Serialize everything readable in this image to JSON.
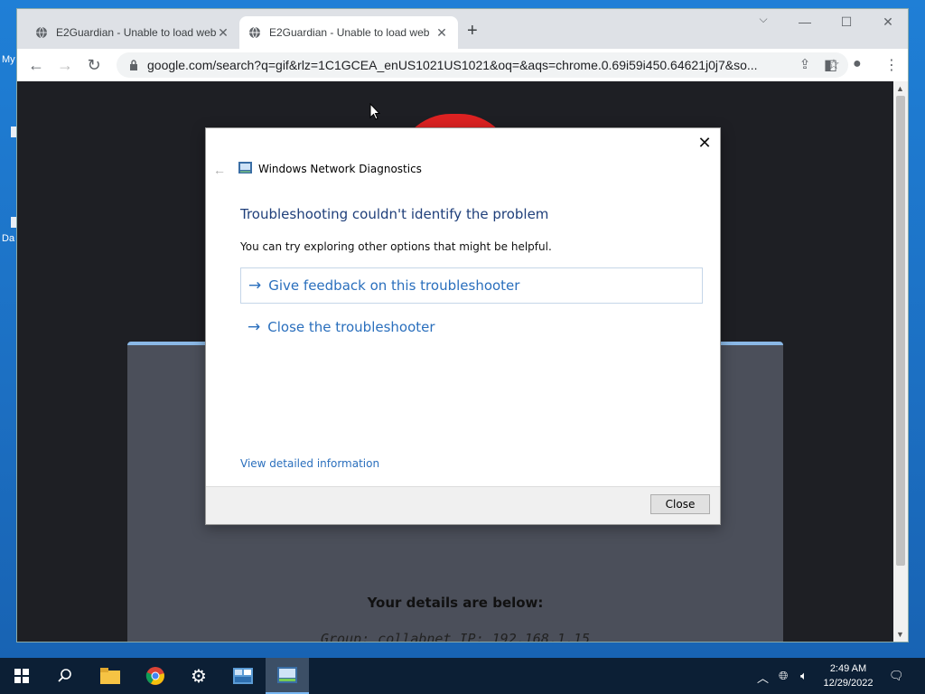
{
  "desktop": {
    "labels": [
      "My",
      "Da"
    ]
  },
  "browser": {
    "tabs": [
      {
        "title": "E2Guardian - Unable to load web",
        "active": false
      },
      {
        "title": "E2Guardian - Unable to load web",
        "active": true
      }
    ],
    "new_tab": "+",
    "url": "google.com/search?q=gif&rlz=1C1GCEA_enUS1021US1021&oq=&aqs=chrome.0.69i59i450.64621j0j7&so..."
  },
  "page": {
    "details_heading": "Your details are below:",
    "details_line": "Group: collabnet   IP: 192.168.1.15"
  },
  "dialog": {
    "app_title": "Windows Network Diagnostics",
    "heading": "Troubleshooting couldn't identify the problem",
    "subtitle": "You can try exploring other options that might be helpful.",
    "options": [
      {
        "label": "Give feedback on this troubleshooter"
      },
      {
        "label": "Close the troubleshooter"
      }
    ],
    "detail_link": "View detailed information",
    "close_button": "Close"
  },
  "taskbar": {
    "time": "2:49 AM",
    "date": "12/29/2022"
  },
  "colors": {
    "accent_link": "#2a6fbd",
    "heading": "#1f3f7a",
    "desktop_bg": "#1f7fd6",
    "taskbar_bg": "#0c1f35"
  }
}
